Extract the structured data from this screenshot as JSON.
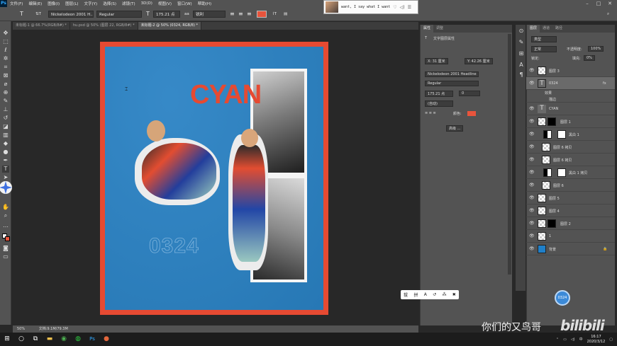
{
  "menubar": {
    "items": [
      "文件(F)",
      "编辑(E)",
      "图像(I)",
      "图层(L)",
      "文字(Y)",
      "选择(S)",
      "滤镜(T)",
      "3D(D)",
      "视图(V)",
      "窗口(W)",
      "帮助(H)"
    ]
  },
  "options": {
    "font_family": "Nickelodeon 2001 H...",
    "font_style": "Regular",
    "font_size": "175.21 点",
    "antialias": "锐利",
    "color": "#e8543c"
  },
  "popup": {
    "text": "want, I say what I want"
  },
  "tabs": [
    {
      "label": "未标题-1 @ 66.7%(RGB/8#) *",
      "active": false
    },
    {
      "label": "hu.psd @ 50% (图层 22, RGB/8#) *",
      "active": false
    },
    {
      "label": "未标题-2 @ 50% (0324, RGB/8) *",
      "active": true
    }
  ],
  "poster": {
    "title": "CYAN",
    "date": "0324",
    "border_color": "#e64a32",
    "bg_color": "#2a82c4"
  },
  "status": {
    "zoom": "50%",
    "doc": "文档:9.1M/79.3M"
  },
  "properties": {
    "tabs": [
      "属性",
      "调整"
    ],
    "header": "文字图层属性",
    "x": "X: 31 厘米",
    "y": "Y: 42.26 厘米",
    "font_family": "Nickelodeon 2001 Headline",
    "font_style": "Regular",
    "size": "175.21 点",
    "tracking": "0",
    "leading": "(自动)",
    "color_label": "颜色:",
    "more_button": "高级 ..."
  },
  "layers": {
    "tabs": [
      "图层",
      "通道",
      "路径"
    ],
    "kind": "类型",
    "blend": "正常",
    "opacity_label": "不透明度:",
    "opacity": "100%",
    "lock_label": "锁定:",
    "fill_label": "填充:",
    "fill": "0%",
    "items": [
      {
        "name": "图层 3",
        "type": "pixel",
        "selected": false
      },
      {
        "name": "0324",
        "type": "text",
        "selected": true,
        "fx": "fx"
      },
      {
        "name": "效果",
        "type": "sub",
        "selected": false
      },
      {
        "name": "描边",
        "type": "sub",
        "selected": false
      },
      {
        "name": "CYAN",
        "type": "text",
        "selected": false
      },
      {
        "name": "图层 1",
        "type": "pixel",
        "selected": false
      },
      {
        "name": "黑白 1",
        "type": "adjust",
        "selected": false
      },
      {
        "name": "图层 6 拷贝",
        "type": "pixel",
        "selected": false
      },
      {
        "name": "图层 6 拷贝",
        "type": "pixel",
        "selected": false
      },
      {
        "name": "黑白 1 拷贝",
        "type": "adjust",
        "selected": false
      },
      {
        "name": "图层 6",
        "type": "pixel",
        "selected": false
      },
      {
        "name": "图层 5",
        "type": "pixel",
        "selected": false
      },
      {
        "name": "图层 4",
        "type": "pixel",
        "selected": false
      },
      {
        "name": "图层 2",
        "type": "pixel",
        "selected": false
      },
      {
        "name": "1",
        "type": "pixel",
        "selected": false
      },
      {
        "name": "背景",
        "type": "background",
        "selected": false
      }
    ]
  },
  "ime": {
    "items": [
      "拔",
      "拼",
      "A",
      "↺",
      "⁂",
      "✖"
    ]
  },
  "avatar_label": "0324",
  "watermark": {
    "text": "你们的又鸟哥",
    "logo": "bilibili"
  },
  "taskbar": {
    "time": "16:17",
    "date": "2020/3/12"
  }
}
